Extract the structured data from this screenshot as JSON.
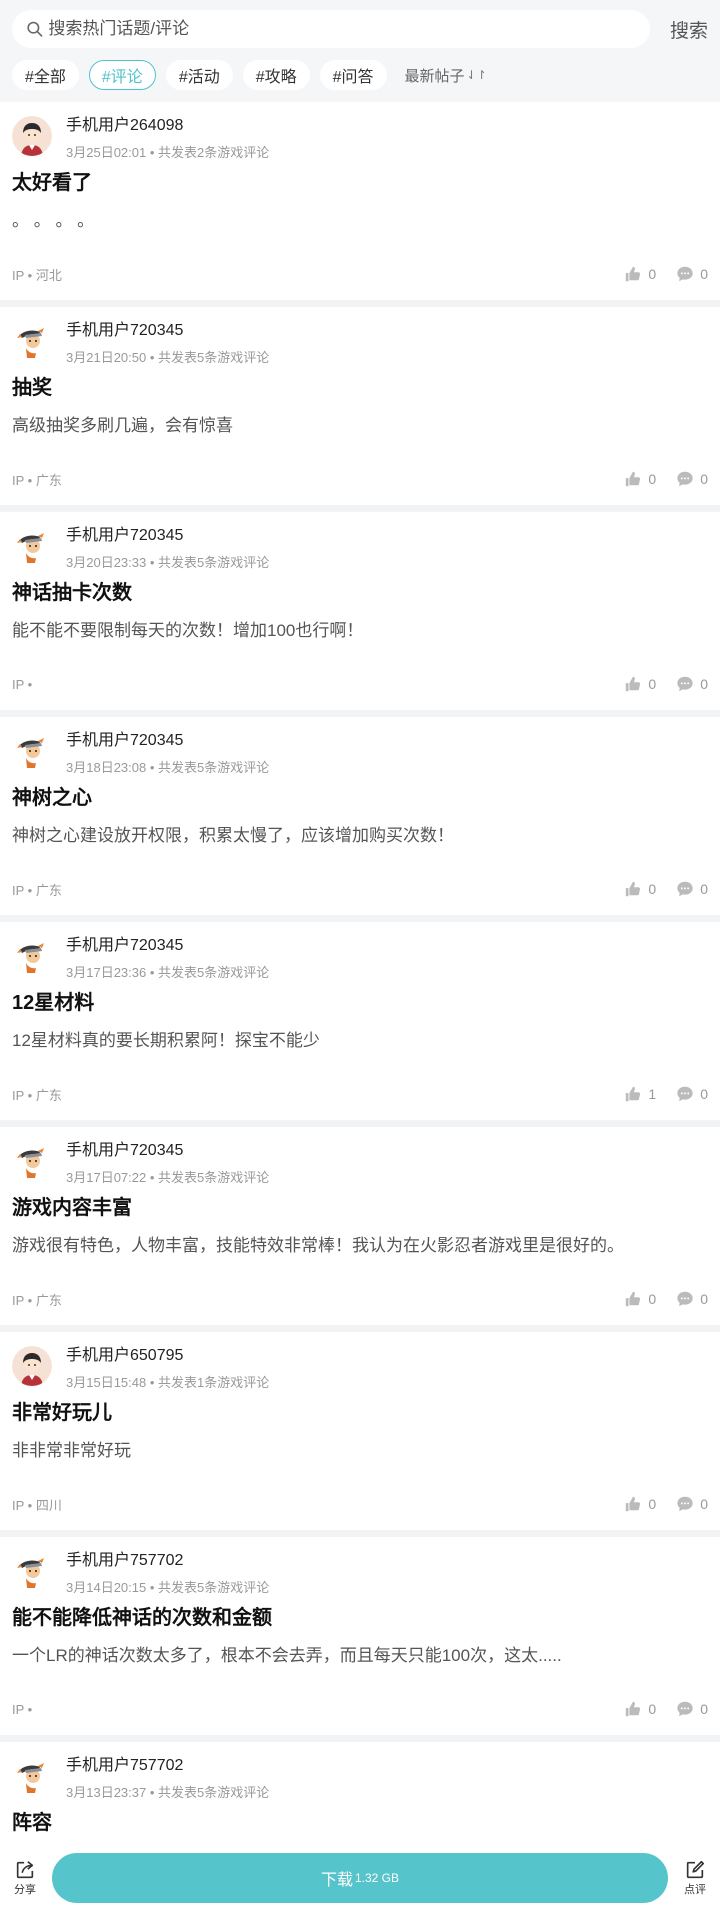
{
  "search": {
    "placeholder": "搜索热门话题/评论",
    "button": "搜索"
  },
  "tags": [
    "#全部",
    "#评论",
    "#活动",
    "#攻略",
    "#问答"
  ],
  "sort": {
    "label": "最新帖子",
    "arrows": "⇃↾"
  },
  "posts": [
    {
      "username": "手机用户264098",
      "meta": "3月25日02:01 • 共发表2条游戏评论",
      "title": "太好看了",
      "body": "。 。 。 。",
      "ip": "IP • 河北",
      "likes": "0",
      "comments": "0",
      "avatar": "boy"
    },
    {
      "username": "手机用户720345",
      "meta": "3月21日20:50 • 共发表5条游戏评论",
      "title": "抽奖",
      "body": "高级抽奖多刷几遍，会有惊喜",
      "ip": "IP • 广东",
      "likes": "0",
      "comments": "0",
      "avatar": "ninja"
    },
    {
      "username": "手机用户720345",
      "meta": "3月20日23:33 • 共发表5条游戏评论",
      "title": "神话抽卡次数",
      "body": "能不能不要限制每天的次数！增加100也行啊！",
      "ip": "IP •",
      "likes": "0",
      "comments": "0",
      "avatar": "ninja"
    },
    {
      "username": "手机用户720345",
      "meta": "3月18日23:08 • 共发表5条游戏评论",
      "title": "神树之心",
      "body": "神树之心建设放开权限，积累太慢了，应该增加购买次数！",
      "ip": "IP • 广东",
      "likes": "0",
      "comments": "0",
      "avatar": "ninja"
    },
    {
      "username": "手机用户720345",
      "meta": "3月17日23:36 • 共发表5条游戏评论",
      "title": "12星材料",
      "body": "12星材料真的要长期积累阿！探宝不能少",
      "ip": "IP • 广东",
      "likes": "1",
      "comments": "0",
      "avatar": "ninja"
    },
    {
      "username": "手机用户720345",
      "meta": "3月17日07:22 • 共发表5条游戏评论",
      "title": "游戏内容丰富",
      "body": "游戏很有特色，人物丰富，技能特效非常棒！我认为在火影忍者游戏里是很好的。",
      "ip": "IP • 广东",
      "likes": "0",
      "comments": "0",
      "avatar": "ninja"
    },
    {
      "username": "手机用户650795",
      "meta": "3月15日15:48 • 共发表1条游戏评论",
      "title": "非常好玩儿",
      "body": "非非常非常好玩",
      "ip": "IP • 四川",
      "likes": "0",
      "comments": "0",
      "avatar": "boy"
    },
    {
      "username": "手机用户757702",
      "meta": "3月14日20:15 • 共发表5条游戏评论",
      "title": "能不能降低神话的次数和金额",
      "body": "一个LR的神话次数太多了，根本不会去弄，而且每天只能100次，这太.....",
      "ip": "IP •",
      "likes": "0",
      "comments": "0",
      "avatar": "ninja"
    },
    {
      "username": "手机用户757702",
      "meta": "3月13日23:37 • 共发表5条游戏评论",
      "title": "阵容",
      "body": "",
      "ip": "",
      "likes": "",
      "comments": "",
      "avatar": "ninja"
    }
  ],
  "bottom": {
    "share": "分享",
    "download": "下载",
    "size": "1.32 GB",
    "review": "点评"
  },
  "colors": {
    "accent": "#56c4cb",
    "tag_active": "#4fc3cb"
  }
}
